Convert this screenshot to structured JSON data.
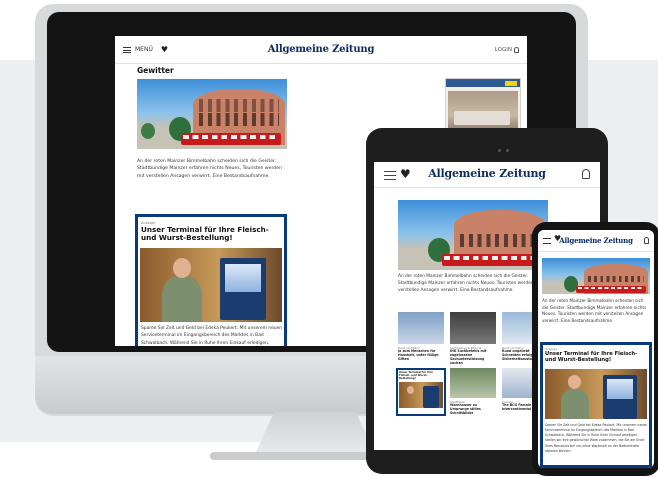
{
  "colors": {
    "brand_navy": "#0c2c63",
    "teaser_border": "#0a3a7e",
    "train_red": "#c71b1b",
    "ikea_yellow": "#f8d400",
    "ikea_blue": "#2f5b92"
  },
  "header": {
    "menu_label": "MENÜ",
    "logo": "Allgemeine Zeitung",
    "login_label": "LOGIN"
  },
  "icons": [
    "menu-icon",
    "heart-icon",
    "user-icon"
  ],
  "article": {
    "partial_heading": "Gewitter",
    "caption": "An der roten Mainzer Bimmelbahn scheiden sich die Geister. Stadtbundige Mainzer erfahren nichts Neues, Touristen werden mit verstellen Ansagen verwirrt. Eine Bestandsaufnahme.",
    "teaser": {
      "kicker": "Anzeige",
      "title": "Unser Terminal für Ihre Fleisch- und Wurst-Bestellung!",
      "body": "Sparen Sie Zeit und Geld bei Edeka Peukert. Mit unserem neuen Serviceterminal im Eingangsbereich des Marktes in Bad Schwalbach. Während Sie in Ruhe Ihren Einkauf erledigen, stellen wir Ihre gewünschte Ware zusammen, die Sie am Ende Ihres Besuches bei uns ohne Wartezeit an der Bedientheke abholen können."
    }
  },
  "tablet": {
    "tiles": [
      {
        "kicker": "Rund um Mainz",
        "title": "Ja zum Menschen für Haushalt, unter fällige Giften"
      },
      {
        "kicker": "Sachbeitrag & Bildung",
        "title": "IHK Suchbefehls mit zugelassene Sachunterstützung suchen"
      },
      {
        "kicker": "Rund um Mainz",
        "title": "Rund ungeliebt Schneiden erfolgt im Sicherheitszustand"
      },
      {
        "kicker": "Stadtleben",
        "title": "Warnhauser zu Ursprunge stilles Schnittbilder"
      },
      {
        "kicker": "Anzeige",
        "title": "The BCG Female Intercontinental"
      }
    ]
  }
}
